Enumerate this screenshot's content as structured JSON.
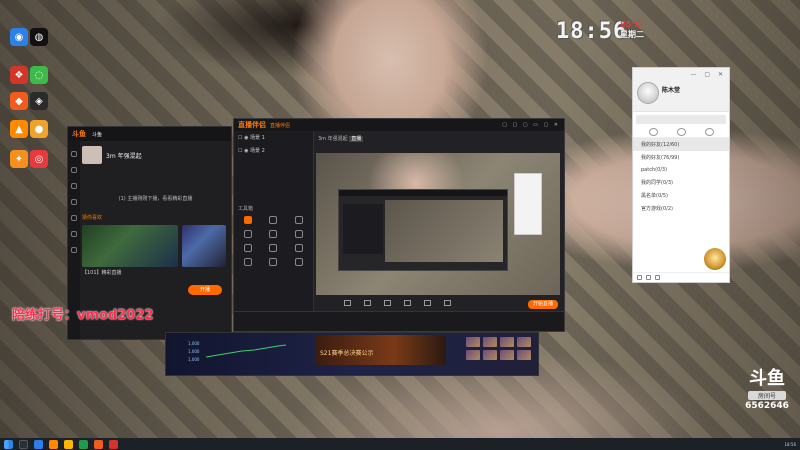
{
  "clock": {
    "time": "18:56",
    "temp": "85°C",
    "day": "星期二"
  },
  "desktop_icons": [
    {
      "label": "",
      "color": "#2e7fe8",
      "glyph": "◉"
    },
    {
      "label": "",
      "color": "#111111",
      "glyph": "◍"
    },
    {
      "label": "",
      "color": "#f15b1c",
      "glyph": "◆"
    },
    {
      "label": "",
      "color": "#2a2a2a",
      "glyph": "◈"
    },
    {
      "label": "",
      "color": "#ff8a00",
      "glyph": "▲"
    },
    {
      "label": "",
      "color": "#f0a32b",
      "glyph": "●"
    },
    {
      "label": "",
      "color": "#f5901f",
      "glyph": "✦"
    },
    {
      "label": "",
      "color": "#e8393c",
      "glyph": "◎"
    },
    {
      "label": "",
      "color": "#d2362b",
      "glyph": "❖"
    },
    {
      "label": "",
      "color": "#3dba4a",
      "glyph": "◌"
    }
  ],
  "qq": {
    "name": "陈木堂",
    "signature": "",
    "search_placeholder": "",
    "groups": [
      {
        "label": "我的好友(12/60)",
        "selected": true
      },
      {
        "label": "我的好友(76/99)",
        "selected": false
      },
      {
        "label": "patch(0/3)",
        "selected": false
      },
      {
        "label": "我的同学(0/3)",
        "selected": false
      },
      {
        "label": "黑名单(0/5)",
        "selected": false
      },
      {
        "label": "官方游戏(0/2)",
        "selected": false
      }
    ]
  },
  "client": {
    "tabs": [
      {
        "label": "斗鱼",
        "on": true
      },
      {
        "label": "",
        "on": false
      },
      {
        "label": "",
        "on": false
      }
    ],
    "streamer_name": "3m 年强混起",
    "streamer_sub": "",
    "message": "(1) 主播刚刚下播，看看精彩直播",
    "section_title": "猜你喜欢",
    "thumbs": [
      {
        "caption": "【101】精彩直播"
      },
      {
        "caption": ""
      }
    ],
    "open_live_label": "开播"
  },
  "watermark": "陪练打号：vmod2022",
  "obs": {
    "tabs": [
      {
        "label": "直播伴侣",
        "on": true
      },
      {
        "label": "",
        "on": false
      },
      {
        "label": "",
        "on": false
      }
    ],
    "controls": "▢ ▢ ▢ ▭ ▢ ✕",
    "scenes": [
      "场景 1",
      "场景 2"
    ],
    "info_title": "3m 年强混起",
    "info_tag": "直播",
    "tools_title": "工具箱",
    "tools": [
      {
        "label": "",
        "hot": true
      },
      {
        "label": "",
        "hot": false
      },
      {
        "label": "",
        "hot": false
      },
      {
        "label": "",
        "hot": false
      },
      {
        "label": "",
        "hot": false
      },
      {
        "label": "",
        "hot": false
      },
      {
        "label": "",
        "hot": false
      },
      {
        "label": "",
        "hot": false
      },
      {
        "label": "",
        "hot": false
      },
      {
        "label": "",
        "hot": false
      },
      {
        "label": "",
        "hot": false
      },
      {
        "label": "",
        "hot": false
      }
    ],
    "bottom_buttons": [
      {
        "label": ""
      },
      {
        "label": ""
      },
      {
        "label": ""
      },
      {
        "label": ""
      },
      {
        "label": ""
      },
      {
        "label": ""
      }
    ],
    "start_live_label": "开始直播",
    "status_text": ""
  },
  "game": {
    "banner_text": "S21赛季总决赛公示",
    "graph_labels": [
      "1,000",
      "1,000",
      "1,000"
    ],
    "caption": ""
  },
  "badge": {
    "logo": "斗鱼",
    "tag": "房间号",
    "room_id": "6562646"
  },
  "taskbar": {
    "time": "18:56",
    "date": ""
  }
}
